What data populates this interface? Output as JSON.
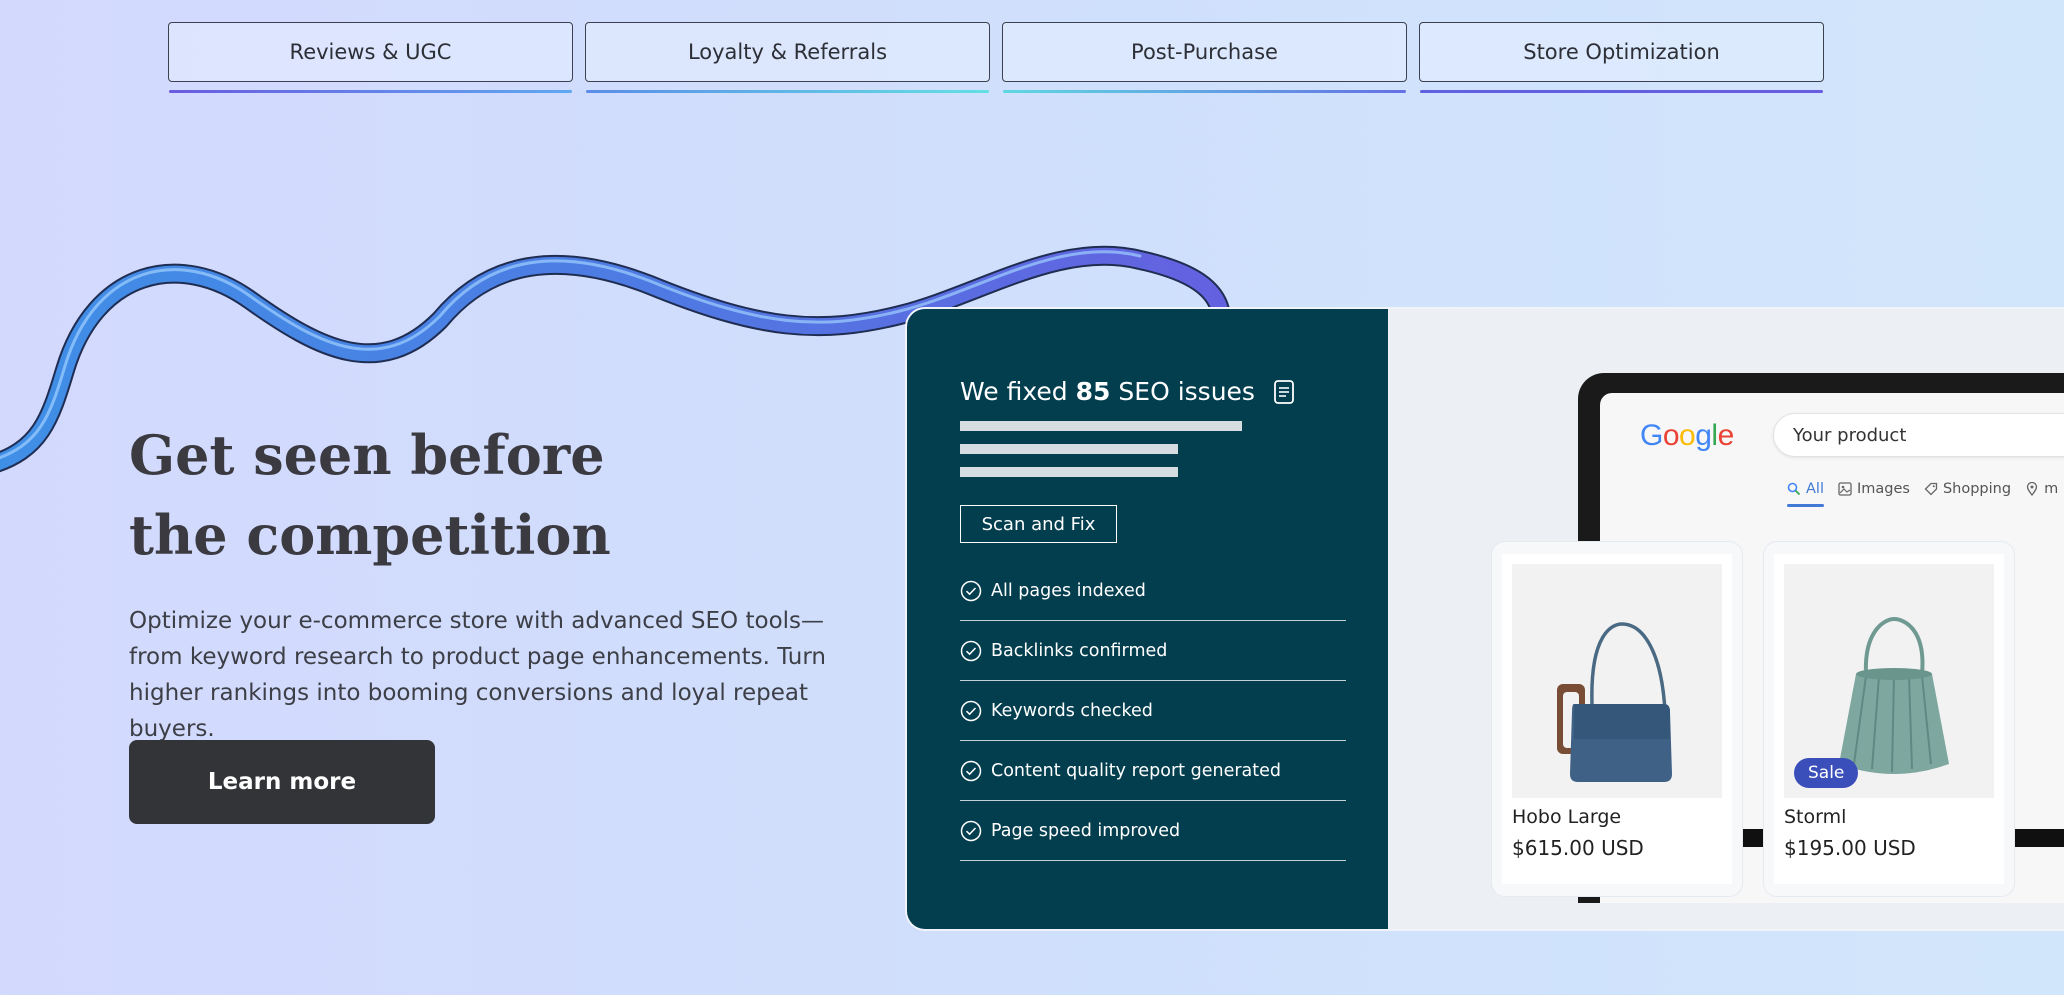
{
  "tabs": [
    {
      "label": "Reviews & UGC"
    },
    {
      "label": "Loyalty & Referrals"
    },
    {
      "label": "Post-Purchase"
    },
    {
      "label": "Store Optimization"
    }
  ],
  "hero": {
    "title": "Get seen before the competition",
    "description": "Optimize your e-commerce store with advanced SEO tools—from keyword research to product page enhancements. Turn higher rankings into booming conversions and loyal repeat buyers.",
    "cta_label": "Learn more"
  },
  "seo_card": {
    "title_prefix": "We fixed",
    "issues_count": "85",
    "title_suffix": "SEO issues",
    "scan_button": "Scan and Fix",
    "checklist": [
      {
        "label": "All pages indexed"
      },
      {
        "label": "Backlinks confirmed"
      },
      {
        "label": "Keywords checked"
      },
      {
        "label": "Content quality report generated"
      },
      {
        "label": "Page speed improved"
      }
    ]
  },
  "search_mock": {
    "logo_text": "Google",
    "search_value": "Your product",
    "tabs": [
      {
        "label": "All",
        "icon": "search-icon"
      },
      {
        "label": "Images",
        "icon": "image-icon"
      },
      {
        "label": "Shopping",
        "icon": "tag-icon"
      },
      {
        "label": "m",
        "icon": "map-pin-icon"
      }
    ],
    "products": [
      {
        "name": "Hobo Large",
        "price": "$615.00 USD"
      },
      {
        "name": "Storml",
        "price": "$195.00 USD",
        "badge": "Sale"
      }
    ]
  },
  "colors": {
    "accent_dark": "#033e4f",
    "cta_bg": "#333438",
    "google_blue": "#4285f4",
    "sale_badge": "#3b4fba"
  }
}
